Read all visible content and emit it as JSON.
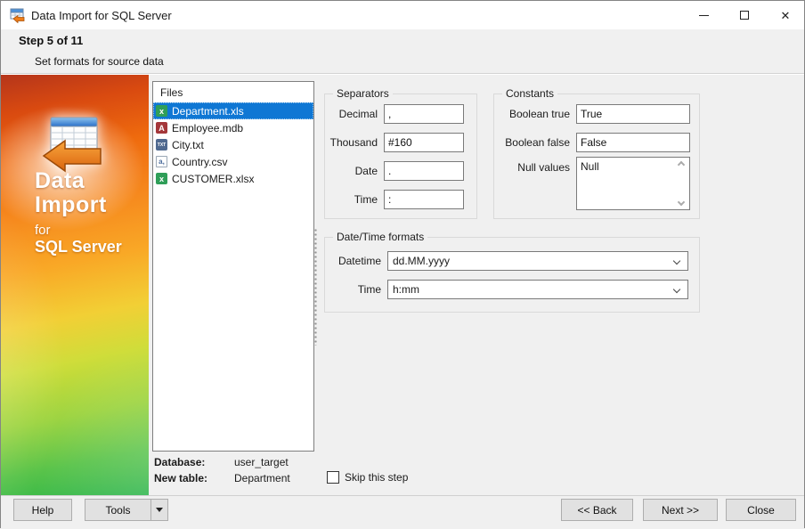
{
  "window": {
    "title": "Data Import for SQL Server",
    "close_glyph": "✕"
  },
  "header": {
    "step": "Step 5 of 11",
    "subtitle": "Set formats for source data"
  },
  "branding": {
    "line1": "Data",
    "line2": "Import",
    "line3": "for",
    "line4": "SQL Server"
  },
  "files": {
    "title": "Files",
    "items": [
      {
        "label": "Department.xls",
        "icon": "excel-file-icon",
        "glyph": "x",
        "selected": true
      },
      {
        "label": "Employee.mdb",
        "icon": "access-file-icon",
        "glyph": "A",
        "selected": false
      },
      {
        "label": "City.txt",
        "icon": "text-file-icon",
        "glyph": "TXT",
        "selected": false
      },
      {
        "label": "Country.csv",
        "icon": "csv-file-icon",
        "glyph": "a,",
        "selected": false
      },
      {
        "label": "CUSTOMER.xlsx",
        "icon": "excel-file-icon",
        "glyph": "x",
        "selected": false
      }
    ],
    "database_label": "Database:",
    "database_value": "user_target",
    "new_table_label": "New table:",
    "new_table_value": "Department"
  },
  "separators": {
    "title": "Separators",
    "decimal_label": "Decimal",
    "decimal_value": ",",
    "thousand_label": "Thousand",
    "thousand_value": "#160",
    "date_label": "Date",
    "date_value": ".",
    "time_label": "Time",
    "time_value": ":"
  },
  "constants": {
    "title": "Constants",
    "bool_true_label": "Boolean true",
    "bool_true_value": "True",
    "bool_false_label": "Boolean false",
    "bool_false_value": "False",
    "null_label": "Null values",
    "null_value": "Null"
  },
  "datetime_formats": {
    "title": "Date/Time formats",
    "datetime_label": "Datetime",
    "datetime_value": "dd.MM.yyyy",
    "time_label": "Time",
    "time_value": "h:mm"
  },
  "skip": {
    "label": "Skip this step",
    "checked": false
  },
  "footer": {
    "help": "Help",
    "tools": "Tools",
    "back": "<< Back",
    "next": "Next >>",
    "close": "Close"
  },
  "colors": {
    "selection_blue": "#0f77d4",
    "brand_orange": "#f68a1e",
    "brand_green": "#2db54c",
    "excel_green": "#2f9e58",
    "access_red": "#a4373a",
    "txt_blue": "#50698f",
    "window_bg": "#f0f0f0"
  }
}
